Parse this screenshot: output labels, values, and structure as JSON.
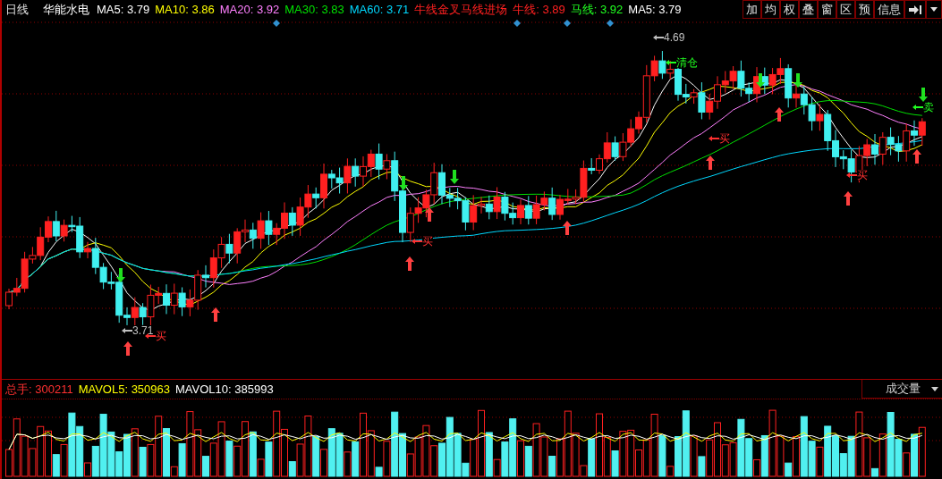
{
  "header": {
    "period": "日线",
    "stock_name": "华能水电",
    "indicators": [
      {
        "text": "MA5: 3.79",
        "color": "#ffffff"
      },
      {
        "text": "MA10: 3.86",
        "color": "#ffff00"
      },
      {
        "text": "MA20: 3.92",
        "color": "#ff80ff"
      },
      {
        "text": "MA30: 3.83",
        "color": "#00e000"
      },
      {
        "text": "MA60: 3.71",
        "color": "#00d8ff"
      },
      {
        "text": "牛线金叉马线进场",
        "color": "#ff2020"
      },
      {
        "text": "牛线: 3.89",
        "color": "#ff2020"
      },
      {
        "text": "马线: 3.92",
        "color": "#20ff20"
      },
      {
        "text": "MA5: 3.79",
        "color": "#ffffff"
      }
    ]
  },
  "toolbar": {
    "buttons": [
      "加",
      "均",
      "权",
      "叠",
      "窗",
      "区",
      "预",
      "信息"
    ]
  },
  "chart": {
    "annotations": [
      {
        "kind": "high",
        "text": "4.69"
      },
      {
        "kind": "clear",
        "text": "清仓"
      },
      {
        "kind": "low",
        "text": "3.71"
      },
      {
        "kind": "buy",
        "text": "买"
      },
      {
        "kind": "buy",
        "text": "买"
      },
      {
        "kind": "buy",
        "text": "买"
      },
      {
        "kind": "buy",
        "text": "买"
      },
      {
        "kind": "sell",
        "text": "卖"
      }
    ]
  },
  "volume": {
    "indicators": [
      {
        "text": "总手: 300211",
        "color": "#ff3030"
      },
      {
        "text": "MAVOL5: 350963",
        "color": "#ffff00"
      },
      {
        "text": "MAVOL10: 385993",
        "color": "#ffffff"
      }
    ],
    "selector": "成交量"
  }
}
